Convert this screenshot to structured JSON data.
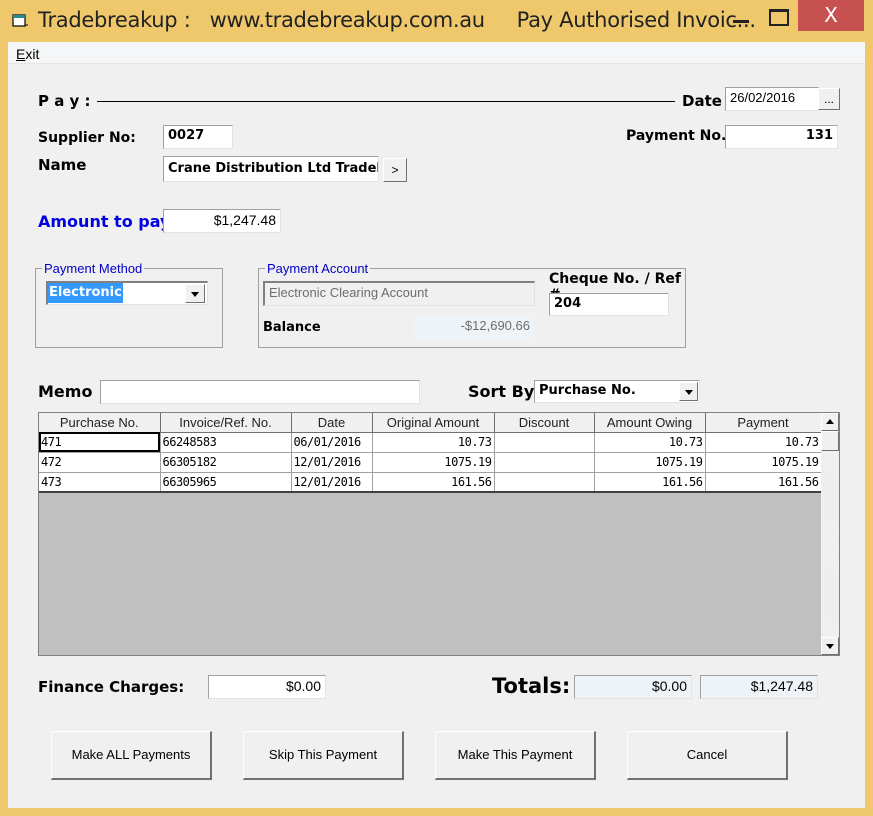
{
  "window": {
    "title": "Tradebreakup :   www.tradebreakup.com.au     Pay Authorised Invoic...",
    "close_glyph": "X"
  },
  "menu": {
    "exit_label_accel": "E",
    "exit_label_rest": "xit"
  },
  "header": {
    "pay_label": "P a y :",
    "date_label": "Date",
    "date_value": "26/02/2016",
    "date_button": "...",
    "supplier_no_label": "Supplier No:",
    "supplier_no_value": "0027",
    "payment_no_label": "Payment No.",
    "payment_no_value": "131",
    "name_label": "Name",
    "name_value": "Crane Distribution Ltd Tradelin",
    "name_button": ">",
    "amount_to_pay_label": "Amount to pay",
    "amount_to_pay_value": "$1,247.48"
  },
  "payment_method": {
    "group_title": "Payment Method",
    "selected": "Electronic"
  },
  "payment_account": {
    "group_title": "Payment Account",
    "account_value": "Electronic Clearing Account",
    "balance_label": "Balance",
    "balance_value": "-$12,690.66",
    "cheque_label": "Cheque No. / Ref #",
    "cheque_value": "204"
  },
  "memo": {
    "label": "Memo",
    "value": ""
  },
  "sort": {
    "label": "Sort By",
    "selected": "Purchase No."
  },
  "grid": {
    "columns": [
      "Purchase No.",
      "Invoice/Ref. No.",
      "Date",
      "Original Amount",
      "Discount",
      "Amount Owing",
      "Payment"
    ],
    "rows": [
      {
        "purchase_no": "471",
        "invoice": "66248583",
        "date": "06/01/2016",
        "original": "10.73",
        "discount": "",
        "owing": "10.73",
        "payment": "10.73"
      },
      {
        "purchase_no": "472",
        "invoice": "66305182",
        "date": "12/01/2016",
        "original": "1075.19",
        "discount": "",
        "owing": "1075.19",
        "payment": "1075.19"
      },
      {
        "purchase_no": "473",
        "invoice": "66305965",
        "date": "12/01/2016",
        "original": "161.56",
        "discount": "",
        "owing": "161.56",
        "payment": "161.56"
      }
    ]
  },
  "footer": {
    "finance_label": "Finance Charges:",
    "finance_value": "$0.00",
    "totals_label": "Totals:",
    "totals_discount": "$0.00",
    "totals_payment": "$1,247.48"
  },
  "buttons": {
    "make_all": "Make ALL Payments",
    "skip": "Skip This Payment",
    "make_this": "Make This Payment",
    "cancel": "Cancel"
  }
}
